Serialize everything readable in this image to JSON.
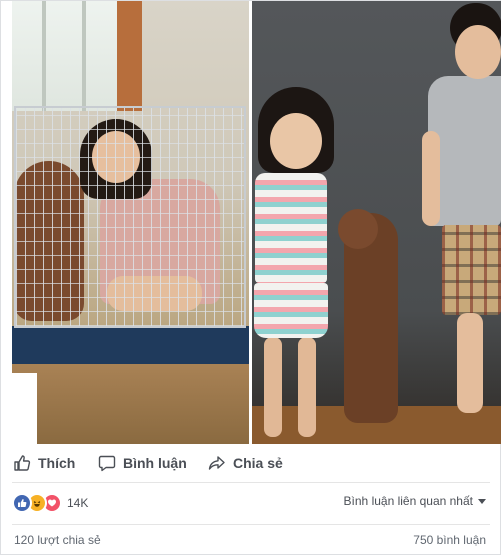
{
  "actions": {
    "like": "Thích",
    "comment": "Bình luận",
    "share": "Chia sẻ"
  },
  "reactions": {
    "count": "14K",
    "types": [
      "like",
      "haha",
      "love"
    ],
    "colors": {
      "like": "#4267b2",
      "haha": "#f7b125",
      "love": "#f25268"
    }
  },
  "sort": {
    "label": "Bình luận liên quan nhất"
  },
  "stats": {
    "shares": "120 lượt chia sẻ",
    "comments": "750 bình luận"
  },
  "icons": [
    "thumbs-up-icon",
    "comment-bubble-icon",
    "share-arrow-icon",
    "like-reaction-icon",
    "haha-reaction-icon",
    "love-reaction-icon",
    "caret-down-icon"
  ]
}
